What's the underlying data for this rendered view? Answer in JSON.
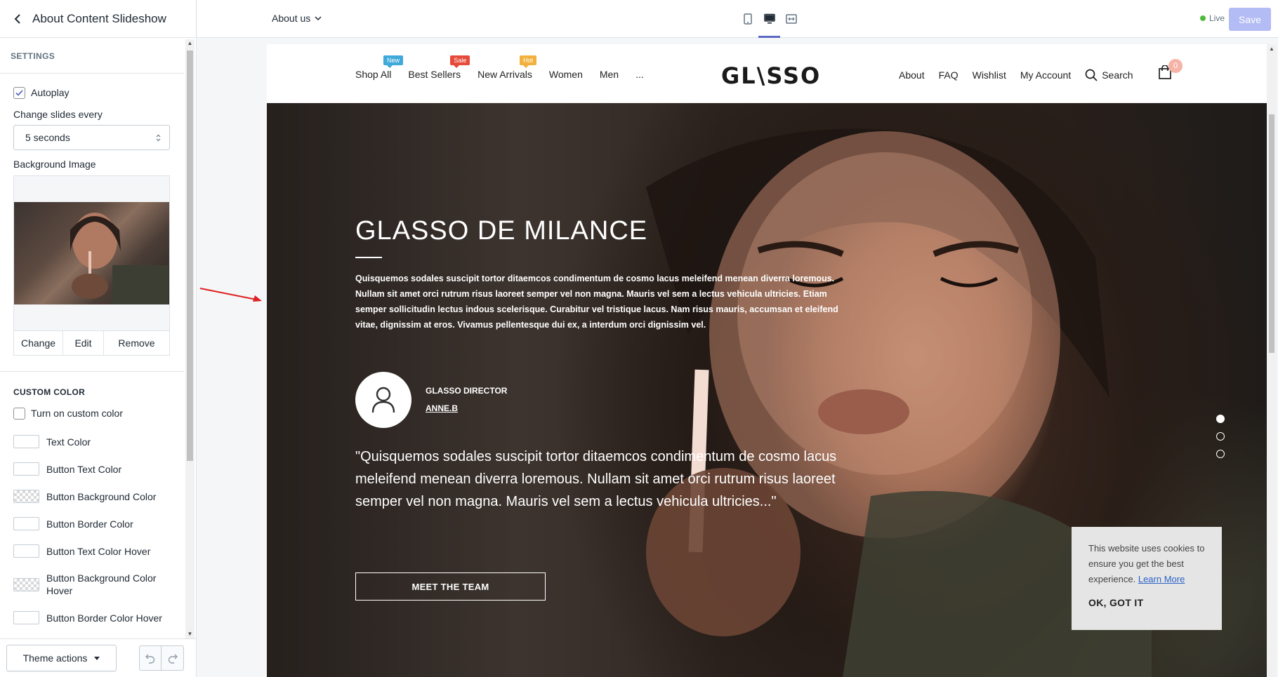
{
  "sidebar": {
    "title": "About Content Slideshow",
    "section_title": "SETTINGS",
    "autoplay_label": "Autoplay",
    "autoplay_checked": true,
    "change_slides_label": "Change slides every",
    "change_slides_value": "5 seconds",
    "background_image_label": "Background Image",
    "image_buttons": [
      "Change",
      "Edit",
      "Remove"
    ],
    "custom_color_title": "CUSTOM COLOR",
    "custom_color_toggle": "Turn on custom color",
    "colors": [
      {
        "label": "Text Color",
        "pattern": false
      },
      {
        "label": "Button Text Color",
        "pattern": false
      },
      {
        "label": "Button Background Color",
        "pattern": true
      },
      {
        "label": "Button Border Color",
        "pattern": false
      },
      {
        "label": "Button Text Color Hover",
        "pattern": false
      },
      {
        "label": "Button Background Color Hover",
        "pattern": true
      },
      {
        "label": "Button Border Color Hover",
        "pattern": false
      }
    ],
    "theme_actions": "Theme actions"
  },
  "topbar": {
    "page_select": "About us",
    "live_label": "Live",
    "save_label": "Save"
  },
  "store": {
    "nav_left": [
      {
        "label": "Shop All",
        "badge": "New",
        "badge_color": "#3fa9d8"
      },
      {
        "label": "Best Sellers",
        "badge": "Sale",
        "badge_color": "#e64a3b"
      },
      {
        "label": "New Arrivals",
        "badge": "Hot",
        "badge_color": "#f2b13e"
      },
      {
        "label": "Women",
        "badge": null,
        "badge_color": null
      },
      {
        "label": "Men",
        "badge": null,
        "badge_color": null
      },
      {
        "label": "...",
        "badge": null,
        "badge_color": null
      }
    ],
    "logo": "GL\\SSO",
    "nav_right": [
      "About",
      "FAQ",
      "Wishlist",
      "My Account"
    ],
    "search_label": "Search",
    "cart_count": "0"
  },
  "hero": {
    "title": "GLASSO DE MILANCE",
    "description": "Quisquemos sodales suscipit tortor ditaemcos condimentum de cosmo lacus meleifend menean diverra loremous. Nullam sit amet orci rutrum risus laoreet semper vel non magna. Mauris vel sem a lectus vehicula ultricies. Etiam semper sollicitudin lectus indous scelerisque. Curabitur vel tristique lacus. Nam risus mauris, accumsan et eleifend vitae, dignissim at eros. Vivamus pellentesque dui ex, a interdum orci dignissim vel.",
    "role": "GLASSO DIRECTOR",
    "name": "ANNE.B",
    "quote": "\"Quisquemos sodales suscipit tortor ditaemcos condimentum de cosmo lacus meleifend menean diverra loremous. Nullam sit amet orci rutrum risus laoreet semper vel non magna. Mauris vel sem a lectus vehicula ultricies...\"",
    "button": "MEET THE TEAM",
    "slide_count": 3,
    "active_slide": 1
  },
  "cookie": {
    "text": "This website uses cookies to ensure you get the best experience.",
    "link": "Learn More",
    "ok": "OK, GOT IT"
  },
  "colors": {
    "accent": "#5c6ac4",
    "save_disabled": "#b3bcf5",
    "live_dot": "#50b83c",
    "annotation_arrow": "#e02020"
  }
}
